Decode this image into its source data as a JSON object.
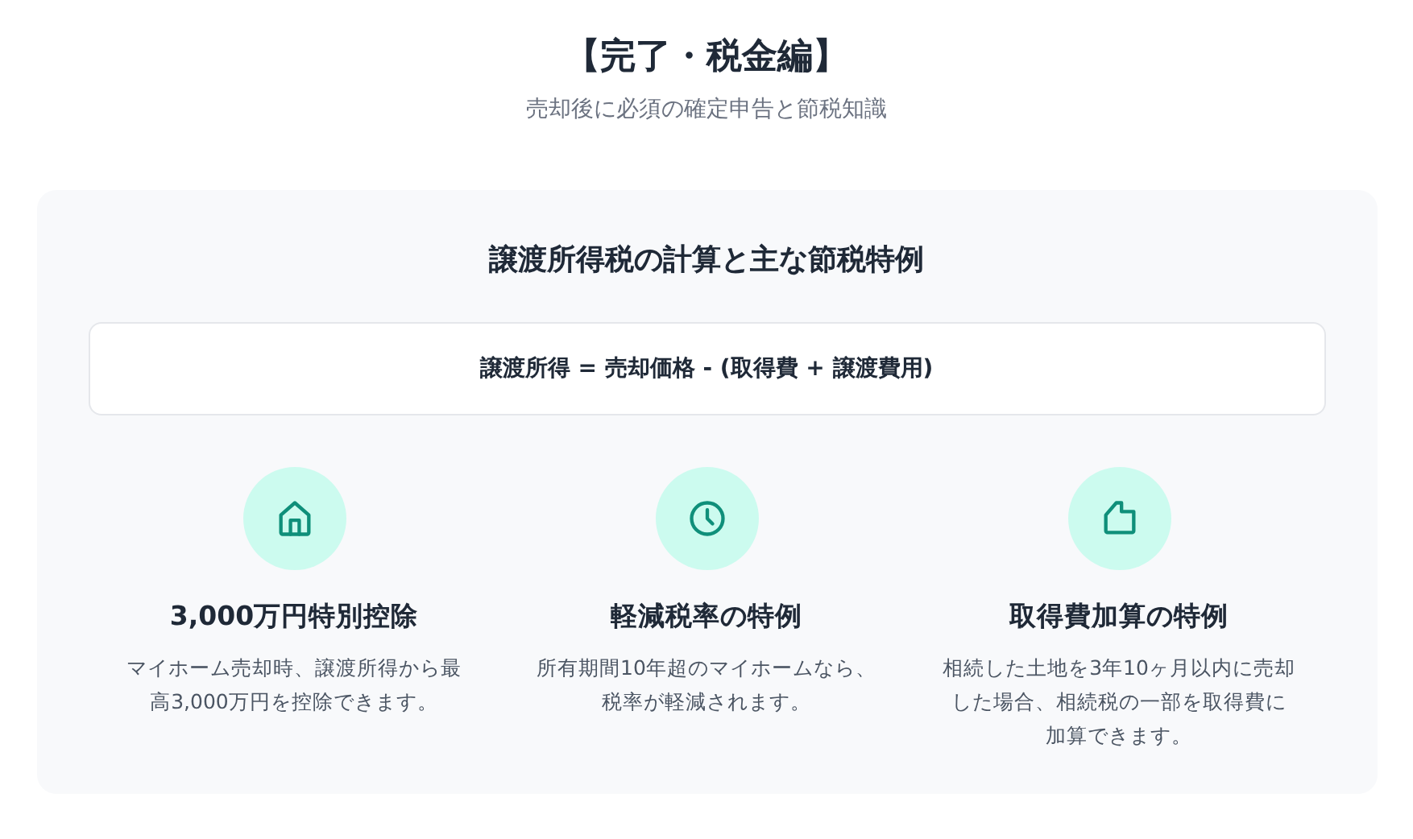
{
  "header": {
    "title": "【完了・税金編】",
    "subtitle": "売却後に必須の確定申告と節税知識"
  },
  "card": {
    "title": "譲渡所得税の計算と主な節税特例",
    "formula": "譲渡所得 = 売却価格 - (取得費 + 譲渡費用)",
    "features": [
      {
        "kind": "house",
        "title": "3,000万円特別控除",
        "lines": [
          "マイホーム売却時、譲渡所得から最",
          "高3,000万円を控除できます。"
        ]
      },
      {
        "kind": "clock",
        "title": "軽減税率の特例",
        "lines": [
          "所有期間10年超のマイホームなら、",
          "税率が軽減されます。"
        ]
      },
      {
        "kind": "document",
        "title": "取得費加算の特例",
        "lines": [
          "相続した土地を3年10ヶ月以内に売却",
          "した場合、相続税の一部を取得費に",
          "加算できます。"
        ]
      }
    ]
  }
}
